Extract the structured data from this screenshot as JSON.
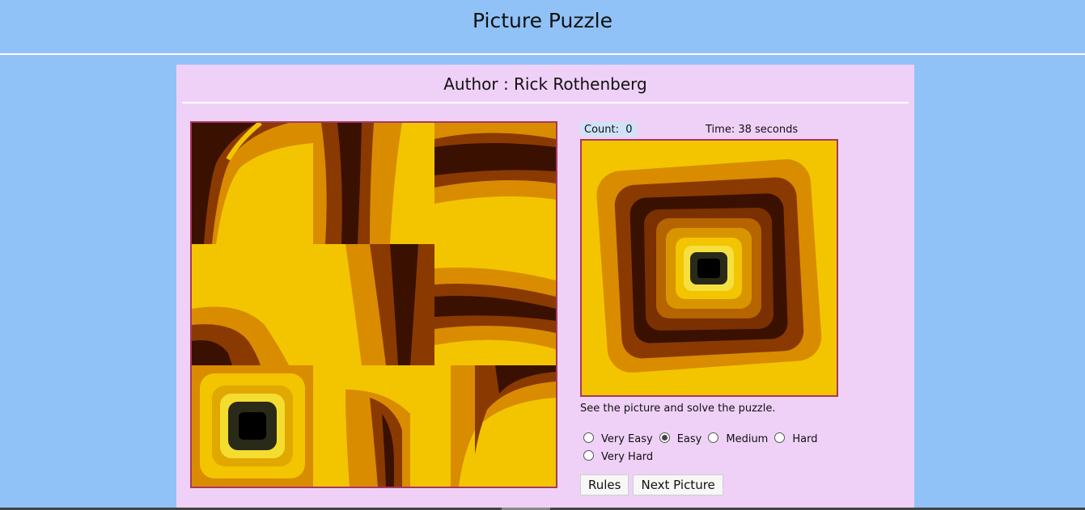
{
  "page": {
    "title": "Picture Puzzle"
  },
  "panel": {
    "author": "Author : Rick Rothenberg"
  },
  "status": {
    "count_label": "Count:",
    "count_value": "0",
    "time_text": "Time: 38 seconds"
  },
  "instruction": "See the picture and solve the puzzle.",
  "difficulty": {
    "options": [
      "Very Easy",
      "Easy",
      "Medium",
      "Hard",
      "Very Hard"
    ],
    "selected": "Easy"
  },
  "buttons": {
    "rules": "Rules",
    "next": "Next Picture"
  },
  "colors": {
    "background": "#90c2f8",
    "panel": "#efd1f8",
    "border": "#a8385a",
    "yellow": "#f2c500",
    "orange": "#d98c00",
    "dark": "#3a1000"
  }
}
